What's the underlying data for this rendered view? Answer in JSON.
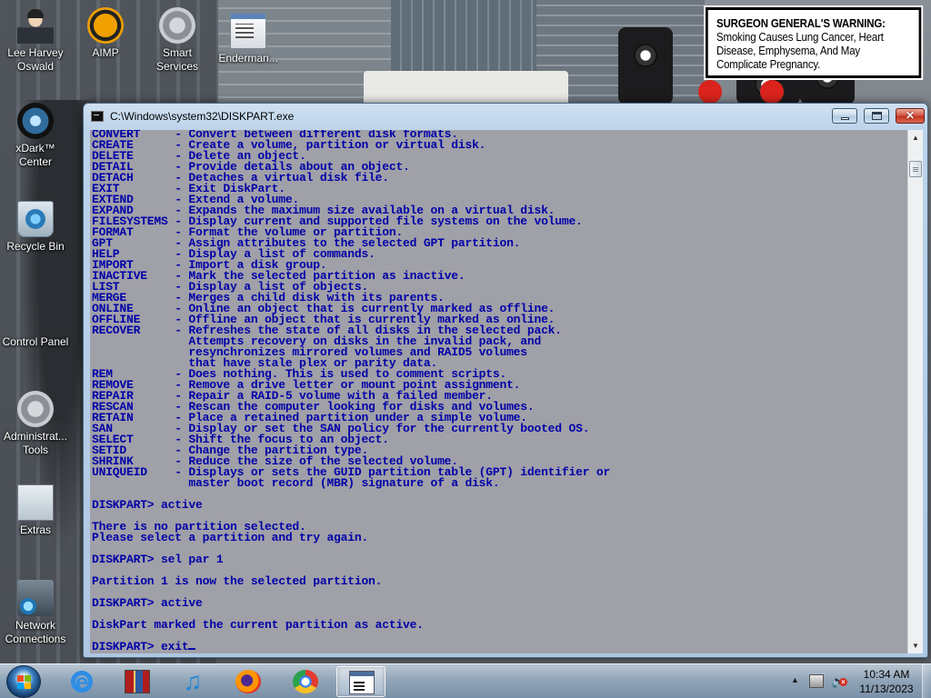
{
  "desktop": {
    "warning": {
      "lead": "SURGEON GENERAL'S WARNING:",
      "body": "Smoking Causes Lung Cancer, Heart Disease, Emphysema, And May Complicate Pregnancy."
    },
    "icons": [
      {
        "label": "Lee Harvey Oswald",
        "icon": "person-icon"
      },
      {
        "label": "AIMP",
        "icon": "aimp-icon"
      },
      {
        "label": "Smart Services",
        "icon": "services-gear-icon"
      },
      {
        "label": "Enderman...",
        "icon": "application-icon"
      },
      {
        "label": "xDark™ Center",
        "icon": "xdark-icon"
      },
      {
        "label": "Recycle Bin",
        "icon": "recycle-bin-icon"
      },
      {
        "label": "Control Panel",
        "icon": "control-panel-icon"
      },
      {
        "label": "Administrat... Tools",
        "icon": "admin-tools-icon"
      },
      {
        "label": "Extras",
        "icon": "extras-icon"
      },
      {
        "label": "Network Connections",
        "icon": "network-icon"
      }
    ]
  },
  "window": {
    "title": "C:\\Windows\\system32\\DISKPART.exe",
    "controls": {
      "minimize": "minimize",
      "maximize": "maximize",
      "close": "✕"
    },
    "console_lines": [
      "CONVERT     - Convert between different disk formats.",
      "CREATE      - Create a volume, partition or virtual disk.",
      "DELETE      - Delete an object.",
      "DETAIL      - Provide details about an object.",
      "DETACH      - Detaches a virtual disk file.",
      "EXIT        - Exit DiskPart.",
      "EXTEND      - Extend a volume.",
      "EXPAND      - Expands the maximum size available on a virtual disk.",
      "FILESYSTEMS - Display current and supported file systems on the volume.",
      "FORMAT      - Format the volume or partition.",
      "GPT         - Assign attributes to the selected GPT partition.",
      "HELP        - Display a list of commands.",
      "IMPORT      - Import a disk group.",
      "INACTIVE    - Mark the selected partition as inactive.",
      "LIST        - Display a list of objects.",
      "MERGE       - Merges a child disk with its parents.",
      "ONLINE      - Online an object that is currently marked as offline.",
      "OFFLINE     - Offline an object that is currently marked as online.",
      "RECOVER     - Refreshes the state of all disks in the selected pack.",
      "              Attempts recovery on disks in the invalid pack, and",
      "              resynchronizes mirrored volumes and RAID5 volumes",
      "              that have stale plex or parity data.",
      "REM         - Does nothing. This is used to comment scripts.",
      "REMOVE      - Remove a drive letter or mount point assignment.",
      "REPAIR      - Repair a RAID-5 volume with a failed member.",
      "RESCAN      - Rescan the computer looking for disks and volumes.",
      "RETAIN      - Place a retained partition under a simple volume.",
      "SAN         - Display or set the SAN policy for the currently booted OS.",
      "SELECT      - Shift the focus to an object.",
      "SETID       - Change the partition type.",
      "SHRINK      - Reduce the size of the selected volume.",
      "UNIQUEID    - Displays or sets the GUID partition table (GPT) identifier or",
      "              master boot record (MBR) signature of a disk.",
      "",
      "DISKPART> active",
      "",
      "There is no partition selected.",
      "Please select a partition and try again.",
      "",
      "DISKPART> sel par 1",
      "",
      "Partition 1 is now the selected partition.",
      "",
      "DISKPART> active",
      "",
      "DiskPart marked the current partition as active.",
      "",
      "DISKPART> exit"
    ],
    "colors": {
      "console_bg": "#a0a0a8",
      "console_text": "#0000a8"
    }
  },
  "taskbar": {
    "items": [
      {
        "name": "internet-explorer",
        "icon": "internet-explorer-icon"
      },
      {
        "name": "archiver",
        "icon": "archiver-icon"
      },
      {
        "name": "music-player",
        "icon": "music-note-icon"
      },
      {
        "name": "firefox",
        "icon": "firefox-icon"
      },
      {
        "name": "chrome",
        "icon": "chrome-icon"
      },
      {
        "name": "diskpart-console",
        "icon": "console-window-icon",
        "active": true
      }
    ],
    "clock": {
      "time": "10:34 AM",
      "date": "11/13/2023"
    }
  }
}
